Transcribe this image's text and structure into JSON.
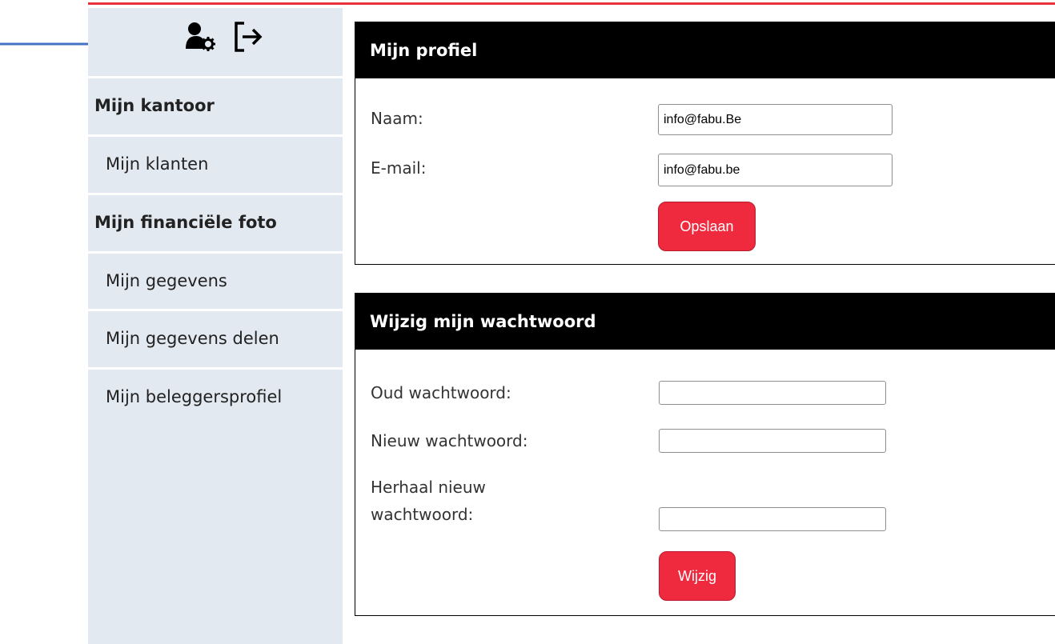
{
  "colors": {
    "accent": "#f02a3e",
    "top_line": "#e8323c",
    "sidebar_bg": "#e3e9f0",
    "panel_header_bg": "#000000",
    "arrow": "#4472c4"
  },
  "header_icons": [
    {
      "icon": "user-gear-icon"
    },
    {
      "icon": "logout-icon"
    }
  ],
  "sidebar": {
    "items": [
      {
        "label": "Mijn kantoor",
        "style": "bold"
      },
      {
        "label": "Mijn klanten",
        "style": "sub"
      },
      {
        "label": "Mijn financiële foto",
        "style": "bold"
      },
      {
        "label": "Mijn gegevens",
        "style": "sub"
      },
      {
        "label": "Mijn gegevens delen",
        "style": "sub"
      },
      {
        "label": "Mijn beleggersprofiel",
        "style": "sub"
      }
    ]
  },
  "profile": {
    "title": "Mijn profiel",
    "name_label": "Naam:",
    "name_value": "info@fabu.Be",
    "email_label": "E-mail:",
    "email_value": "info@fabu.be",
    "save_label": "Opslaan"
  },
  "password": {
    "title": "Wijzig mijn wachtwoord",
    "old_label": "Oud wachtwoord:",
    "old_value": "",
    "new_label": "Nieuw wachtwoord:",
    "new_value": "",
    "repeat_label_line1": "Herhaal nieuw",
    "repeat_label_line2": "wachtwoord:",
    "repeat_value": "",
    "submit_label": "Wijzig"
  }
}
